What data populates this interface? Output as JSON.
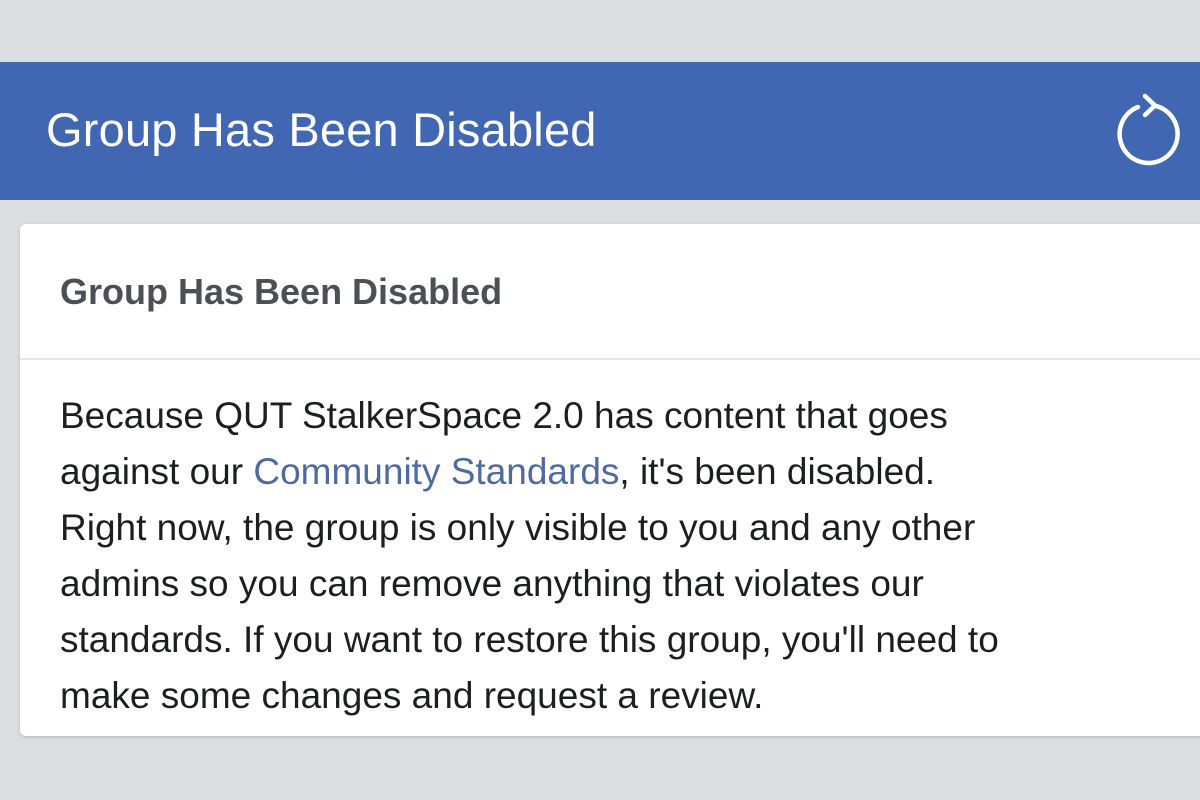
{
  "app_bar": {
    "title": "Group Has Been Disabled",
    "refresh_icon": "refresh-icon",
    "background_color": "#4267b2"
  },
  "card": {
    "title": "Group Has Been Disabled",
    "body": {
      "line1": "Because QUT StalkerSpace 2.0 has content that goes",
      "line2_prefix": "against our ",
      "link_text": "Community Standards",
      "line2_suffix": ", it's been disabled.",
      "line3": "Right now, the group is only visible to you and any other",
      "line4": "admins so you can remove anything that violates our",
      "line5": "standards. If you want to restore this group, you'll need to",
      "line6": "make some changes and request a review."
    },
    "link_color": "#4f6aa3"
  }
}
